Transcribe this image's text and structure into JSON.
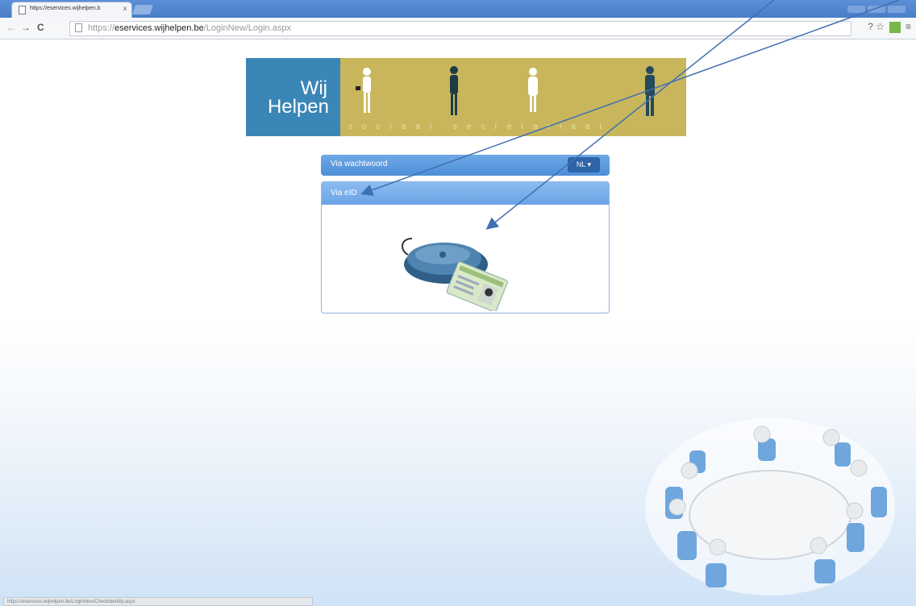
{
  "browser": {
    "tab_title": "https://eservices.wijhelpen.b",
    "tab_close": "x",
    "url_scheme": "https://",
    "url_host": "eservices.wijhelpen.be",
    "url_path": "/LoginNew/Login.aspx",
    "back": "←",
    "forward": "→",
    "reload": "C",
    "tools": "? ☆",
    "menu": "≡",
    "status_url": "https://eservices.wijhelpen.be/LoginNew/CheckIdentity.aspx"
  },
  "banner": {
    "logo_line1": "Wij",
    "logo_line2": "Helpen",
    "tagline": "sociaal secretariaat"
  },
  "login": {
    "password_tab": "Via wachtwoord",
    "language": "NL ▾",
    "eid_tab": "Via eID"
  },
  "colors": {
    "brand_blue": "#3a86b6",
    "banner_gold": "#c9b65c",
    "panel_blue": "#5b99df",
    "arrow": "#3f6fb3"
  }
}
